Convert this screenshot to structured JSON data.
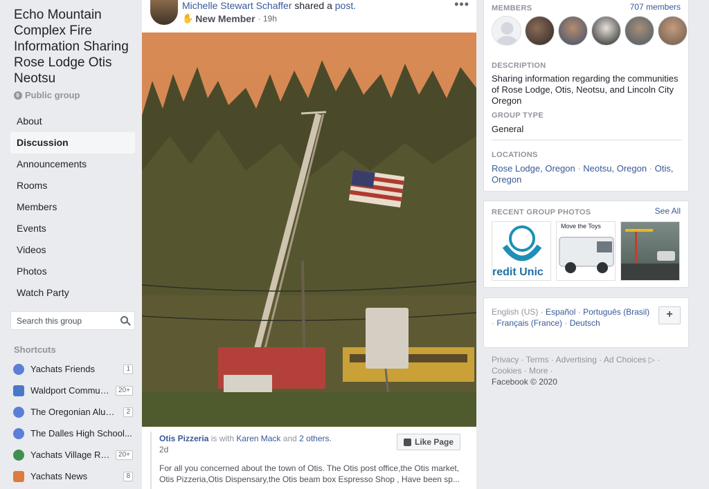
{
  "group": {
    "title": "Echo Mountain Complex Fire Information Sharing Rose Lodge Otis Neotsu",
    "privacy": "Public group"
  },
  "nav": [
    "About",
    "Discussion",
    "Announcements",
    "Rooms",
    "Members",
    "Events",
    "Videos",
    "Photos",
    "Watch Party"
  ],
  "search": {
    "placeholder": "Search this group"
  },
  "shortcuts": {
    "heading": "Shortcuts",
    "items": [
      {
        "name": "Yachats Friends",
        "badge": "1",
        "color": "#5b7fd6"
      },
      {
        "name": "Waldport Community...",
        "badge": "20+",
        "color": "#4a77c9"
      },
      {
        "name": "The Oregonian Alumni...",
        "badge": "2",
        "color": "#5b7fd6"
      },
      {
        "name": "The Dalles High School...",
        "badge": "",
        "color": "#5b7fd6"
      },
      {
        "name": "Yachats Village Re...",
        "badge": "20+",
        "color": "#3f8f4e"
      },
      {
        "name": "Yachats News",
        "badge": "8",
        "color": "#e07a3b"
      }
    ]
  },
  "post": {
    "author": "Michelle Stewart Schaffer",
    "action": "shared a",
    "action_link": "post.",
    "badge": "New Member",
    "time": "· 19h",
    "more": "•••",
    "shared_page": "Otis Pizzeria",
    "with_text": "is with",
    "with_person": "Karen Mack",
    "and_text": "and",
    "others": "2 others.",
    "shared_time": "2d",
    "like_page": "Like Page",
    "text": "For all you concerned about the town of Otis. The Otis post office,the Otis market, Otis Pizzeria,Otis Dispensary,the Otis beam box Espresso Shop , Have been sp..."
  },
  "members": {
    "label": "MEMBERS",
    "count": "707 members"
  },
  "description": {
    "label": "DESCRIPTION",
    "text": "Sharing information regarding the communities of Rose Lodge, Otis, Neotsu, and Lincoln City Oregon"
  },
  "group_type": {
    "label": "GROUP TYPE",
    "value": "General"
  },
  "locations": {
    "label": "LOCATIONS",
    "items": [
      "Rose Lodge, Oregon",
      "Neotsu, Oregon",
      "Otis, Oregon"
    ]
  },
  "recent_photos": {
    "label": "RECENT GROUP PHOTOS",
    "see_all": "See All",
    "photo1_text": "redit Unic",
    "photo2_text": "Move the Toys"
  },
  "languages": {
    "current": "English (US)",
    "others": [
      "Español",
      "Português (Brasil)",
      "Français (France)",
      "Deutsch"
    ],
    "add": "+"
  },
  "footer": {
    "links": [
      "Privacy",
      "Terms",
      "Advertising",
      "Ad Choices",
      "Cookies",
      "More"
    ],
    "copyright": "Facebook © 2020"
  }
}
